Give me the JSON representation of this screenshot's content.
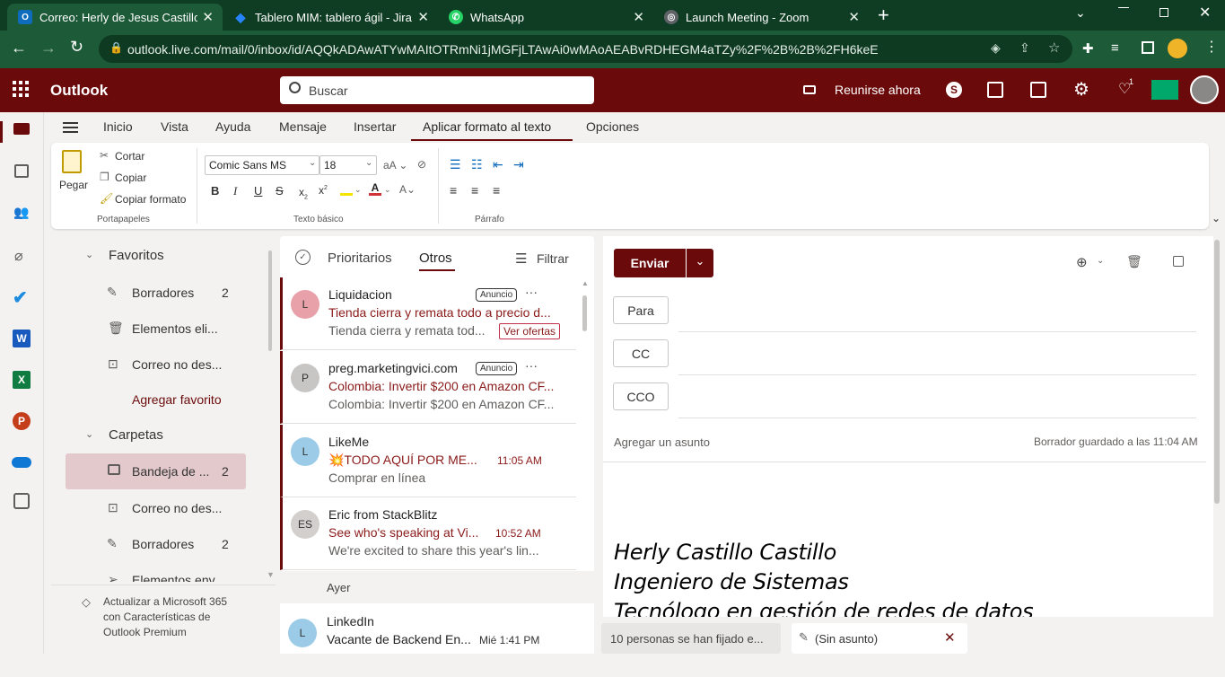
{
  "browser": {
    "tabs": [
      {
        "title": "Correo: Herly de Jesus Castillo Ca",
        "active": true
      },
      {
        "title": "Tablero MIM: tablero ágil - Jira",
        "active": false
      },
      {
        "title": "WhatsApp",
        "active": false
      },
      {
        "title": "Launch Meeting - Zoom",
        "active": false
      }
    ],
    "url": "outlook.live.com/mail/0/inbox/id/AQQkADAwATYwMAItOTRmNi1jMGFjLTAwAi0wMAoAEABvRDHEGM4aTZy%2F%2B%2B%2FH6keE",
    "notif_count": "1"
  },
  "header": {
    "app_name": "Outlook",
    "search_placeholder": "Buscar",
    "meet_now": "Reunirse ahora",
    "tips_count": "1",
    "brand_color": "#6b0a0a"
  },
  "menu_tabs": [
    "Inicio",
    "Vista",
    "Ayuda",
    "Mensaje",
    "Insertar",
    "Aplicar formato al texto",
    "Opciones"
  ],
  "ribbon": {
    "paste": "Pegar",
    "cut": "Cortar",
    "copy": "Copiar",
    "format_painter": "Copiar formato",
    "group_clipboard": "Portapapeles",
    "font_name": "Comic Sans MS",
    "font_size": "18",
    "group_basic_text": "Texto básico",
    "group_paragraph": "Párrafo",
    "sub": "x",
    "sup": "x"
  },
  "folders": {
    "favorites_label": "Favoritos",
    "favorites": [
      {
        "label": "Borradores",
        "count": "2"
      },
      {
        "label": "Elementos eli...",
        "count": ""
      },
      {
        "label": "Correo no des...",
        "count": ""
      }
    ],
    "add_favorite": "Agregar favorito",
    "folders_label": "Carpetas",
    "folder_items": [
      {
        "label": "Bandeja de ...",
        "count": "2"
      },
      {
        "label": "Correo no des...",
        "count": ""
      },
      {
        "label": "Borradores",
        "count": "2"
      },
      {
        "label": "Elementos env...",
        "count": ""
      }
    ],
    "upgrade_line1": "Actualizar a Microsoft 365",
    "upgrade_line2": "con Características de",
    "upgrade_line3": "Outlook Premium"
  },
  "maillist": {
    "tab_focused": "Prioritarios",
    "tab_other": "Otros",
    "filter": "Filtrar",
    "ad_badge": "Anuncio",
    "cta": "Ver ofertas",
    "group_yesterday": "Ayer",
    "messages": [
      {
        "initials": "L",
        "sender": "Liquidacion",
        "subject": "Tienda cierra y remata todo a precio d...",
        "preview": "Tienda cierra y remata tod...",
        "time": "",
        "avatar_color": "#e8a1a9"
      },
      {
        "initials": "P",
        "sender": "preg.marketingvici.com",
        "subject": "Colombia: Invertir $200 en Amazon CF...",
        "preview": "Colombia: Invertir $200 en Amazon CF...",
        "time": "",
        "avatar_color": "#c8c6c4"
      },
      {
        "initials": "L",
        "sender": "LikeMe",
        "subject": "💥TODO AQUÍ POR ME...",
        "preview": "Comprar en línea",
        "time": "11:05 AM",
        "avatar_color": "#9ccbe8"
      },
      {
        "initials": "ES",
        "sender": "Eric from StackBlitz",
        "subject": "See who's speaking at Vi...",
        "preview": "We're excited to share this year's lin...",
        "time": "10:52 AM",
        "avatar_color": "#d2cfcd"
      },
      {
        "initials": "L",
        "sender": "LinkedIn",
        "subject": "Vacante de Backend En...",
        "preview": "",
        "time": "Mié 1:41 PM",
        "avatar_color": "#9ccbe8"
      }
    ]
  },
  "compose": {
    "send": "Enviar",
    "to": "Para",
    "cc": "CC",
    "bcc": "CCO",
    "subject_placeholder": "Agregar un asunto",
    "draft_saved": "Borrador guardado a las 11:04 AM",
    "signature": [
      "Herly Castillo Castillo",
      "Ingeniero de Sistemas",
      "Tecnólogo en gestión de redes de datos"
    ]
  },
  "bottom": {
    "pinned": "10 personas se han fijado e...",
    "draft_tab": "(Sin asunto)"
  }
}
